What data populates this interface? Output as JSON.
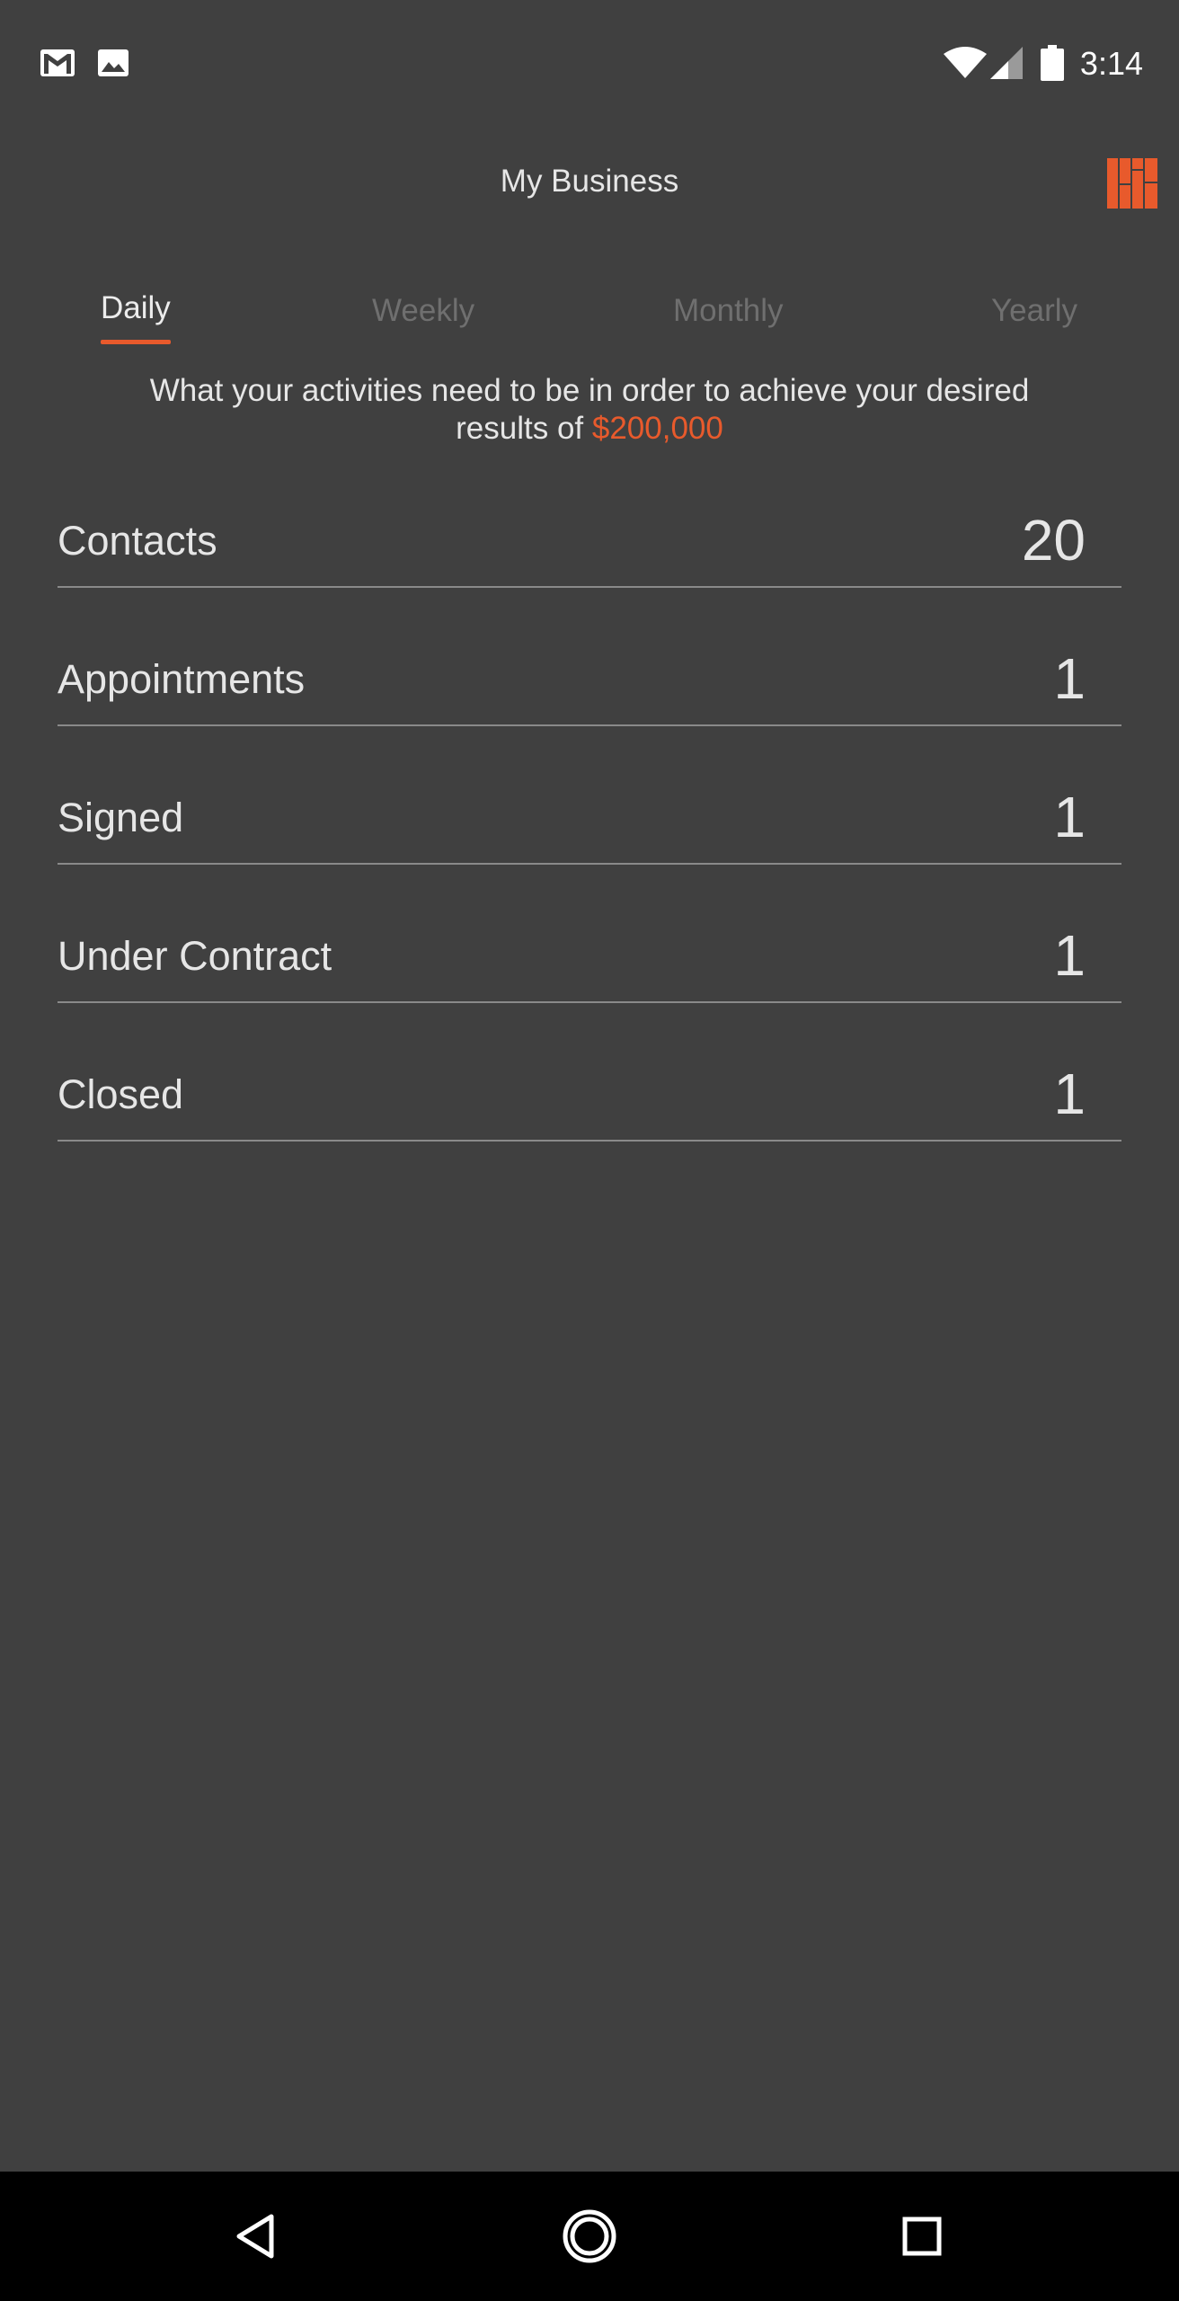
{
  "status_bar": {
    "time": "3:14",
    "left_icons": [
      "gmail-icon",
      "image-icon"
    ],
    "right_icons": [
      "wifi-icon",
      "cell-signal-icon",
      "battery-icon"
    ]
  },
  "header": {
    "title": "My Business",
    "logo_icon": "brand-grid-logo-icon",
    "accent_color": "#e85a2c"
  },
  "tabs": [
    {
      "label": "Daily",
      "active": true
    },
    {
      "label": "Weekly",
      "active": false
    },
    {
      "label": "Monthly",
      "active": false
    },
    {
      "label": "Yearly",
      "active": false
    }
  ],
  "description": {
    "text": "What your activities need to be in order to achieve your desired results of ",
    "amount": "$200,000"
  },
  "metrics": [
    {
      "label": "Contacts",
      "value": "20"
    },
    {
      "label": "Appointments",
      "value": "1"
    },
    {
      "label": "Signed",
      "value": "1"
    },
    {
      "label": "Under Contract",
      "value": "1"
    },
    {
      "label": "Closed",
      "value": "1"
    }
  ],
  "nav_bar": {
    "buttons": [
      "back-icon",
      "home-icon",
      "recents-icon"
    ]
  }
}
